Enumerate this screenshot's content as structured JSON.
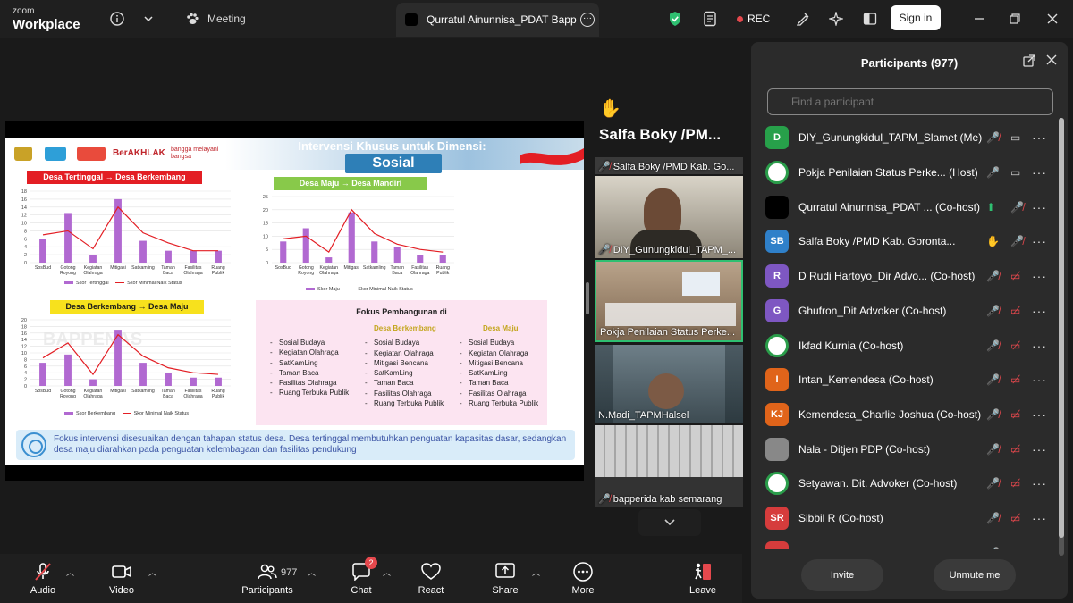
{
  "app": {
    "brand_small": "zoom",
    "brand_big": "Workplace"
  },
  "topbar": {
    "meeting_label": "Meeting",
    "tab_title": "Qurratul Ainunnisa_PDAT Bappenas",
    "rec_label": "REC",
    "signin_label": "Sign in"
  },
  "slide": {
    "title": "Intervensi Khusus untuk Dimensi:",
    "subtitle": "Sosial",
    "brand_berakhlak": "BerAKHLAK",
    "brand_bangga": "bangga melayani bangsa",
    "label_tertinggal": "Desa Tertinggal → Desa Berkembang",
    "label_maju": "Desa Maju → Desa Mandiri",
    "label_berkembang": "Desa Berkembang → Desa Maju",
    "watermark": "BAPPENAS",
    "fokus_title": "Fokus Pembangunan di",
    "fokus_columns": [
      {
        "header": "",
        "items": [
          "Sosial Budaya",
          "Kegiatan Olahraga",
          "SatKamLing",
          "Taman Baca",
          "Fasilitas Olahraga",
          "Ruang Terbuka Publik"
        ]
      },
      {
        "header": "Desa Berkembang",
        "items": [
          "Sosial Budaya",
          "Kegiatan Olahraga",
          "Mitigasi Bencana",
          "SatKamLing",
          "Taman Baca",
          "Fasilitas Olahraga",
          "Ruang Terbuka Publik"
        ]
      },
      {
        "header": "Desa Maju",
        "items": [
          "Sosial Budaya",
          "Kegiatan Olahraga",
          "Mitigasi Bencana",
          "SatKamLing",
          "Taman Baca",
          "Fasilitas Olahraga",
          "Ruang Terbuka Publik"
        ]
      }
    ],
    "note": "Fokus intervensi disesuaikan dengan tahapan status desa. Desa tertinggal membutuhkan penguatan kapasitas dasar, sedangkan desa maju diarahkan pada penguatan kelembagaan dan fasilitas pendukung"
  },
  "chart_data": [
    {
      "type": "bar",
      "categories": [
        "SosBud",
        "Gotong Royong",
        "Kegiatan Olahraga",
        "Mitigasi",
        "Satkamling",
        "Taman Baca",
        "Fasilitas Olahraga",
        "Ruang Publik"
      ],
      "series": [
        {
          "name": "Skor Tertinggal",
          "type": "bar",
          "values": [
            6,
            12.5,
            2,
            16,
            5.5,
            3,
            3,
            3
          ]
        },
        {
          "name": "Skor Minimal Naik Status",
          "type": "line",
          "values": [
            7,
            8,
            3.5,
            14,
            7.5,
            5,
            3,
            3
          ]
        }
      ],
      "ylim": [
        0,
        18
      ],
      "yticks": [
        0,
        2,
        4,
        6,
        8,
        10,
        12,
        14,
        16,
        18
      ],
      "title": "Desa Tertinggal → Desa Berkembang"
    },
    {
      "type": "bar",
      "categories": [
        "SosBud",
        "Gotong Royong",
        "Kegiatan Olahraga",
        "Mitigasi",
        "Satkamling",
        "Taman Baca",
        "Fasilitas Olahraga",
        "Ruang Publik"
      ],
      "series": [
        {
          "name": "Skor Maju",
          "type": "bar",
          "values": [
            8,
            13,
            2,
            19,
            8,
            6,
            3,
            3
          ]
        },
        {
          "name": "Skor Minimal Naik Status",
          "type": "line",
          "values": [
            9,
            10,
            4,
            20,
            11,
            7,
            5,
            4
          ]
        }
      ],
      "ylim": [
        0,
        25
      ],
      "yticks": [
        0,
        5,
        10,
        15,
        20,
        25
      ],
      "title": "Desa Maju → Desa Mandiri"
    },
    {
      "type": "bar",
      "categories": [
        "SosBud",
        "Gotong Royong",
        "Kegiatan Olahraga",
        "Mitigasi",
        "Satkamling",
        "Taman Baca",
        "Fasilitas Olahraga",
        "Ruang Publik"
      ],
      "series": [
        {
          "name": "Skor Berkembang",
          "type": "bar",
          "values": [
            7,
            9.5,
            2,
            17,
            7,
            4,
            2.5,
            2.5
          ]
        },
        {
          "name": "Skor Minimal Naik Status",
          "type": "line",
          "values": [
            8.5,
            13,
            3.5,
            15.5,
            9,
            5.5,
            4,
            3.5
          ]
        }
      ],
      "ylim": [
        0,
        20
      ],
      "yticks": [
        0,
        2,
        4,
        6,
        8,
        10,
        12,
        14,
        16,
        18,
        20
      ],
      "title": "Desa Berkembang → Desa Maju"
    }
  ],
  "speaker": {
    "name": "Salfa Boky /PM..."
  },
  "thumbnails": [
    {
      "name": "Salfa Boky /PMD Kab. Go..."
    },
    {
      "name": "DIY_Gunungkidul_TAPM_..."
    },
    {
      "name": "Pokja Penilaian Status Perke..."
    },
    {
      "name": "N.Madi_TAPMHalsel"
    },
    {
      "name": "bapperida kab semarang"
    }
  ],
  "panel": {
    "title": "Participants (977)",
    "search_placeholder": "Find a participant",
    "invite_label": "Invite",
    "unmute_label": "Unmute me",
    "participants": [
      {
        "initials": "D",
        "color": "#27a04a",
        "name": "DIY_Gunungkidul_TAPM_Slamet (Me)"
      },
      {
        "initials": "",
        "color": "#ffffff",
        "name": "Pokja Penilaian Status Perke... (Host)"
      },
      {
        "initials": "",
        "color": "#000000",
        "name": "Qurratul Ainunnisa_PDAT ... (Co-host)"
      },
      {
        "initials": "SB",
        "color": "#2f80c9",
        "name": "Salfa Boky /PMD Kab. Goronta..."
      },
      {
        "initials": "R",
        "color": "#7e57c2",
        "name": "D Rudi Hartoyo_Dir Advo... (Co-host)"
      },
      {
        "initials": "G",
        "color": "#7e57c2",
        "name": "Ghufron_Dit.Advoker (Co-host)"
      },
      {
        "initials": "",
        "color": "#ffffff",
        "name": "Ikfad Kurnia (Co-host)"
      },
      {
        "initials": "I",
        "color": "#e0641a",
        "name": "Intan_Kemendesa (Co-host)"
      },
      {
        "initials": "KJ",
        "color": "#e0641a",
        "name": "Kemendesa_Charlie Joshua (Co-host)"
      },
      {
        "initials": "",
        "color": "#888888",
        "name": "Nala - Ditjen PDP (Co-host)"
      },
      {
        "initials": "",
        "color": "#ffffff",
        "name": "Setyawan. Dit. Advoker (Co-host)"
      },
      {
        "initials": "SR",
        "color": "#d63c3c",
        "name": "Sibbil R (Co-host)"
      },
      {
        "initials": "DD",
        "color": "#d63c3c",
        "name": "DPMD DUKCAPIL PROV. BALI..."
      }
    ]
  },
  "toolbar": {
    "audio": "Audio",
    "video": "Video",
    "participants": "Participants",
    "participants_count": "977",
    "chat": "Chat",
    "chat_badge": "2",
    "react": "React",
    "share": "Share",
    "more": "More",
    "leave": "Leave"
  },
  "colors": {
    "bar": "#b169d1",
    "line": "#e31e24",
    "accent": "#2fbf71",
    "danger": "#e5484d"
  }
}
